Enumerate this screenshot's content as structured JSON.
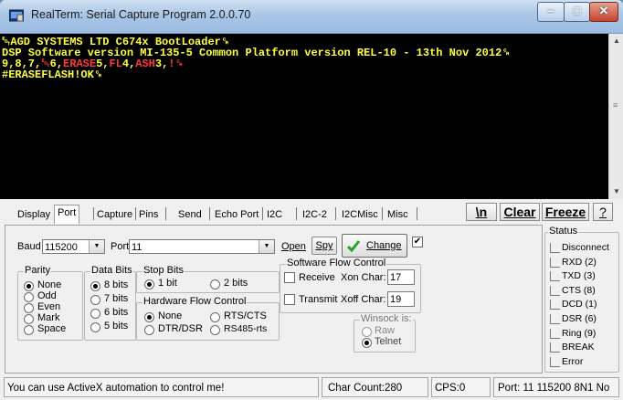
{
  "window": {
    "title": "RealTerm: Serial Capture Program 2.0.0.70"
  },
  "terminal": {
    "lines": [
      "␄AGD SYSTEMS LTD C674x BootLoader␍",
      "DSP Software version MI-135-5 Common Platform version REL-10 - 13th Nov 2012␍"
    ],
    "line3": [
      {
        "text": "9,8,7,",
        "color": "y"
      },
      {
        "text": "␄",
        "color": "r"
      },
      {
        "text": "6,",
        "color": "y"
      },
      {
        "text": "ERASE",
        "color": "r"
      },
      {
        "text": "5,",
        "color": "y"
      },
      {
        "text": "FL",
        "color": "r"
      },
      {
        "text": "4,",
        "color": "y"
      },
      {
        "text": "ASH",
        "color": "r"
      },
      {
        "text": "3,",
        "color": "y"
      },
      {
        "text": "!␍",
        "color": "r"
      }
    ],
    "line4": "#ERASEFLASH!OK␍",
    "colors": {
      "background": "#000000",
      "yellow": "#ffff3a",
      "red": "#ff3a3a"
    }
  },
  "tabs": [
    "Display",
    "Port",
    "Capture",
    "Pins",
    "Send",
    "Echo Port",
    "I2C",
    "I2C-2",
    "I2CMisc",
    "Misc"
  ],
  "active_tab": "Port",
  "toolbar": {
    "newline": "\\n",
    "clear": "Clear",
    "freeze": "Freeze",
    "help": "?"
  },
  "port": {
    "baud_label": "Baud",
    "baud_value": "115200",
    "port_label": "Port",
    "port_value": "11",
    "open": "Open",
    "spy": "Spy",
    "change": "Change",
    "change_checked": true,
    "parity": {
      "title": "Parity",
      "options": [
        "None",
        "Odd",
        "Even",
        "Mark",
        "Space"
      ],
      "selected": "None"
    },
    "data_bits": {
      "title": "Data Bits",
      "options": [
        "8 bits",
        "7 bits",
        "6 bits",
        "5 bits"
      ],
      "selected": "8 bits"
    },
    "stop_bits": {
      "title": "Stop Bits",
      "options": [
        "1 bit",
        "2 bits"
      ],
      "selected": "1 bit"
    },
    "hw_flow": {
      "title": "Hardware Flow Control",
      "options": [
        "None",
        "RTS/CTS",
        "DTR/DSR",
        "RS485-rts"
      ],
      "selected": "None"
    },
    "sw_flow": {
      "title": "Software Flow Control",
      "receive": "Receive",
      "xon_label": "Xon Char:",
      "xon_value": "17",
      "transmit": "Transmit",
      "xoff_label": "Xoff Char:",
      "xoff_value": "19"
    },
    "winsock": {
      "title": "Winsock is:",
      "options": [
        "Raw",
        "Telnet"
      ],
      "selected": "Telnet"
    }
  },
  "status": {
    "title": "Status",
    "items": [
      "Disconnect",
      "RXD (2)",
      "TXD (3)",
      "CTS (8)",
      "DCD (1)",
      "DSR (6)",
      "Ring (9)",
      "BREAK",
      "Error"
    ]
  },
  "statusbar": {
    "message": "You can use ActiveX automation to control me!",
    "char_count": "Char Count:280",
    "cps": "CPS:0",
    "port_info": "Port: 11 115200 8N1 No"
  }
}
